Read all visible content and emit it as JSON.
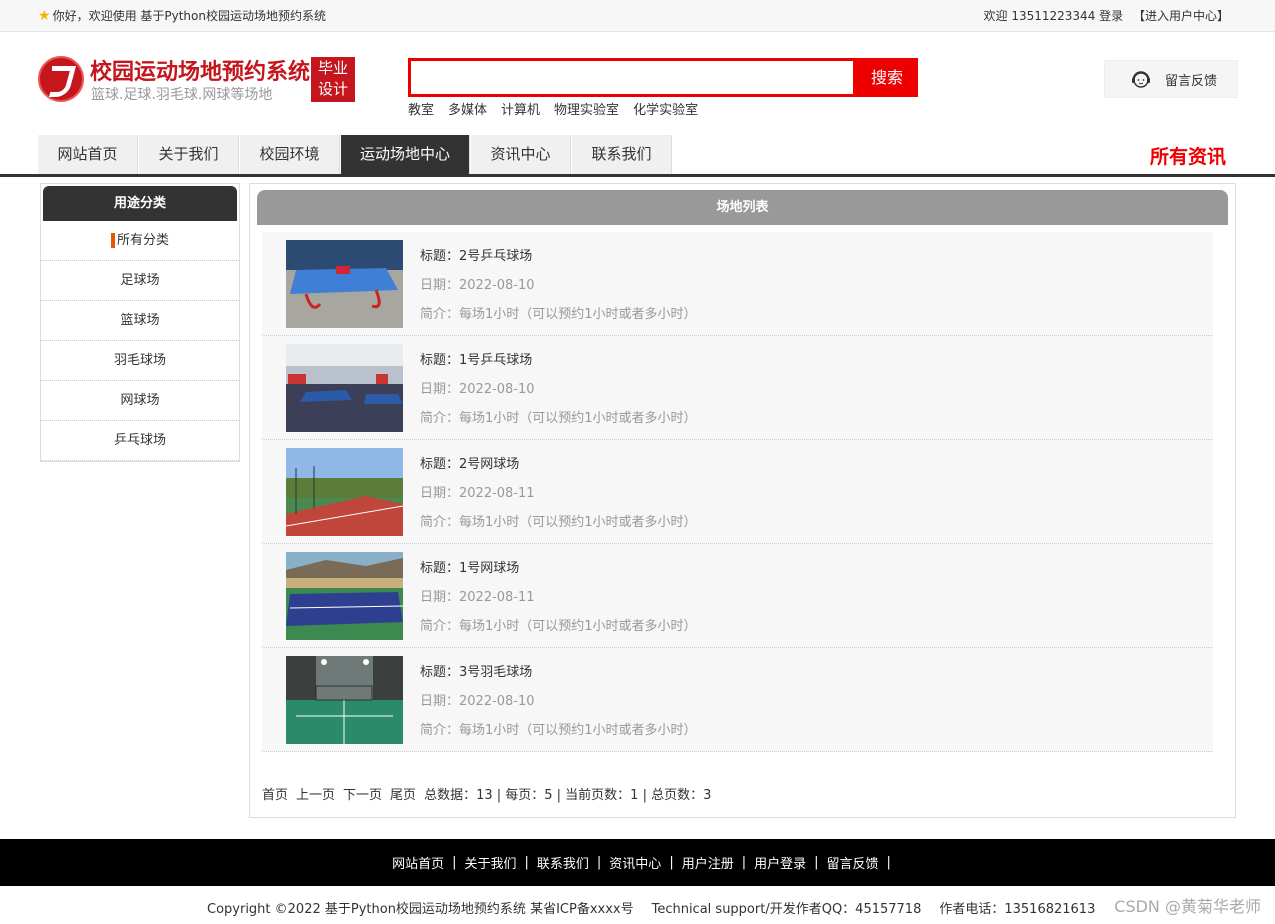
{
  "topbar": {
    "welcome": "你好，欢迎使用 基于Python校园运动场地预约系统",
    "user_text": "欢迎 13511223344 登录",
    "user_center": "【进入用户中心】"
  },
  "header": {
    "site_title": "校园运动场地预约系统",
    "site_sub": "篮球.足球.羽毛球.网球等场地",
    "badge_line1": "毕业",
    "badge_line2": "设计",
    "search_value": "",
    "search_button": "搜索",
    "hot_words": [
      "教室",
      "多媒体",
      "计算机",
      "物理实验室",
      "化学实验室"
    ],
    "feedback": "留言反馈"
  },
  "nav": {
    "items": [
      "网站首页",
      "关于我们",
      "校园环境",
      "运动场地中心",
      "资讯中心",
      "联系我们"
    ],
    "active_index": 3,
    "right_title": "所有资讯"
  },
  "sidebar": {
    "title": "用途分类",
    "categories": [
      "所有分类",
      "足球场",
      "篮球场",
      "羽毛球场",
      "网球场",
      "乒乓球场"
    ]
  },
  "main": {
    "title": "场地列表",
    "items": [
      {
        "title": "标题：2号乒乓球场",
        "date": "日期：2022-08-10",
        "summary": "简介：每场1小时（可以预约1小时或者多小时）",
        "image": "ping-pong-outdoor"
      },
      {
        "title": "标题：1号乒乓球场",
        "date": "日期：2022-08-10",
        "summary": "简介：每场1小时（可以预约1小时或者多小时）",
        "image": "ping-pong-indoor"
      },
      {
        "title": "标题：2号网球场",
        "date": "日期：2022-08-11",
        "summary": "简介：每场1小时（可以预约1小时或者多小时）",
        "image": "tennis-red"
      },
      {
        "title": "标题：1号网球场",
        "date": "日期：2022-08-11",
        "summary": "简介：每场1小时（可以预约1小时或者多小时）",
        "image": "tennis-blue"
      },
      {
        "title": "标题：3号羽毛球场",
        "date": "日期：2022-08-10",
        "summary": "简介：每场1小时（可以预约1小时或者多小时）",
        "image": "badminton"
      }
    ],
    "pager": {
      "first": "首页",
      "prev": "上一页",
      "next": "下一页",
      "last": "尾页",
      "info": "总数据：13 | 每页：5 | 当前页数：1 | 总页数：3"
    }
  },
  "footer": {
    "links": [
      "网站首页",
      "关于我们",
      "联系我们",
      "资讯中心",
      "用户注册",
      "用户登录",
      "留言反馈"
    ],
    "copyright": "Copyright ©2022 基于Python校园运动场地预约系统 某省ICP备xxxx号",
    "support": "Technical support/开发作者QQ：45157718",
    "phone": "作者电话：13516821613",
    "watermark": "CSDN @黄菊华老师"
  },
  "colors": {
    "brand_red": "#c4161c",
    "search_red": "#ee0000",
    "nav_dark": "#333333",
    "accent_orange": "#e55a00"
  }
}
